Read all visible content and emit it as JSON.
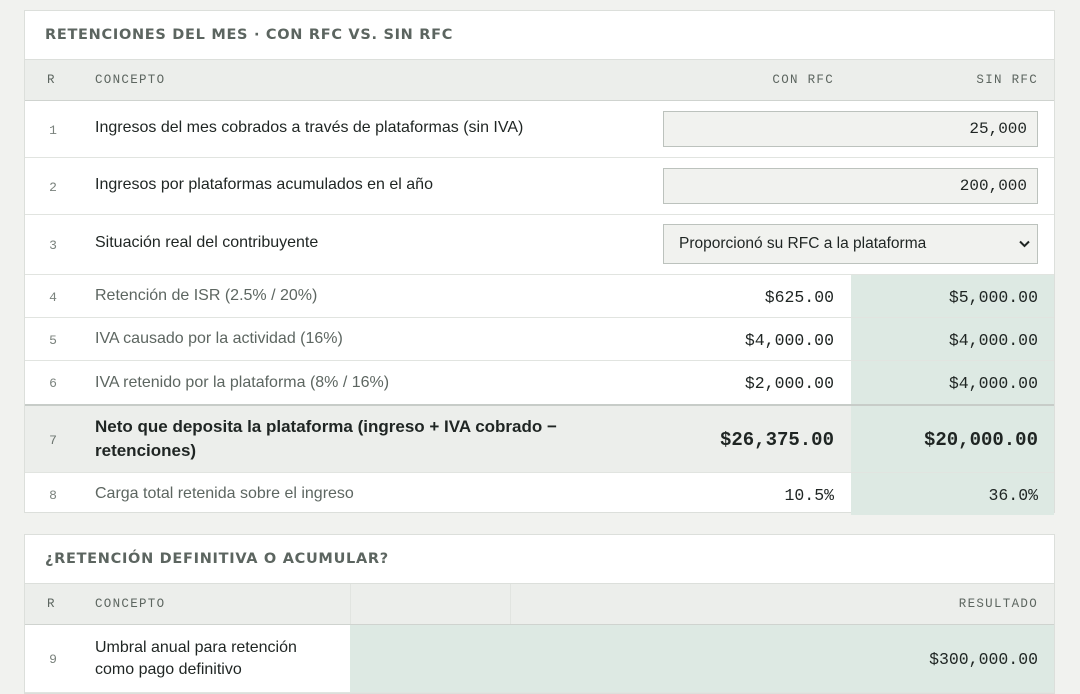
{
  "section1": {
    "title": "RETENCIONES DEL MES · CON RFC VS. SIN RFC",
    "headers": {
      "r": "R",
      "concept": "CONCEPTO",
      "con": "CON RFC",
      "sin": "SIN RFC"
    },
    "rows": [
      {
        "n": "1",
        "concept": "Ingresos del mes cobrados a través de plataformas (sin IVA)",
        "input": "25,000"
      },
      {
        "n": "2",
        "concept": "Ingresos por plataformas acumulados en el año",
        "input": "200,000"
      },
      {
        "n": "3",
        "concept": "Situación real del contribuyente",
        "select": "Proporcionó su RFC a la plataforma"
      },
      {
        "n": "4",
        "concept": "Retención de ISR (2.5% / 20%)",
        "con": "$625.00",
        "sin": "$5,000.00"
      },
      {
        "n": "5",
        "concept": "IVA causado por la actividad (16%)",
        "con": "$4,000.00",
        "sin": "$4,000.00"
      },
      {
        "n": "6",
        "concept": "IVA retenido por la plataforma (8% / 16%)",
        "con": "$2,000.00",
        "sin": "$4,000.00"
      },
      {
        "n": "7",
        "concept": "Neto que deposita la plataforma (ingreso + IVA cobrado − retenciones)",
        "con": "$26,375.00",
        "sin": "$20,000.00"
      },
      {
        "n": "8",
        "concept": "Carga total retenida sobre el ingreso",
        "con": "10.5%",
        "sin": "36.0%"
      }
    ]
  },
  "section2": {
    "title": "¿RETENCIÓN DEFINITIVA O ACUMULAR?",
    "headers": {
      "r": "R",
      "concept": "CONCEPTO",
      "result": "RESULTADO"
    },
    "rows": [
      {
        "n": "9",
        "concept": "Umbral anual para retención como pago definitivo",
        "value": "$300,000.00"
      }
    ]
  },
  "icons": {
    "select_arrow": "chevron-down-icon"
  },
  "colors": {
    "page_bg": "#f1f2ef",
    "result_tint": "#dde9e3",
    "header_bg": "#eceeeb"
  }
}
